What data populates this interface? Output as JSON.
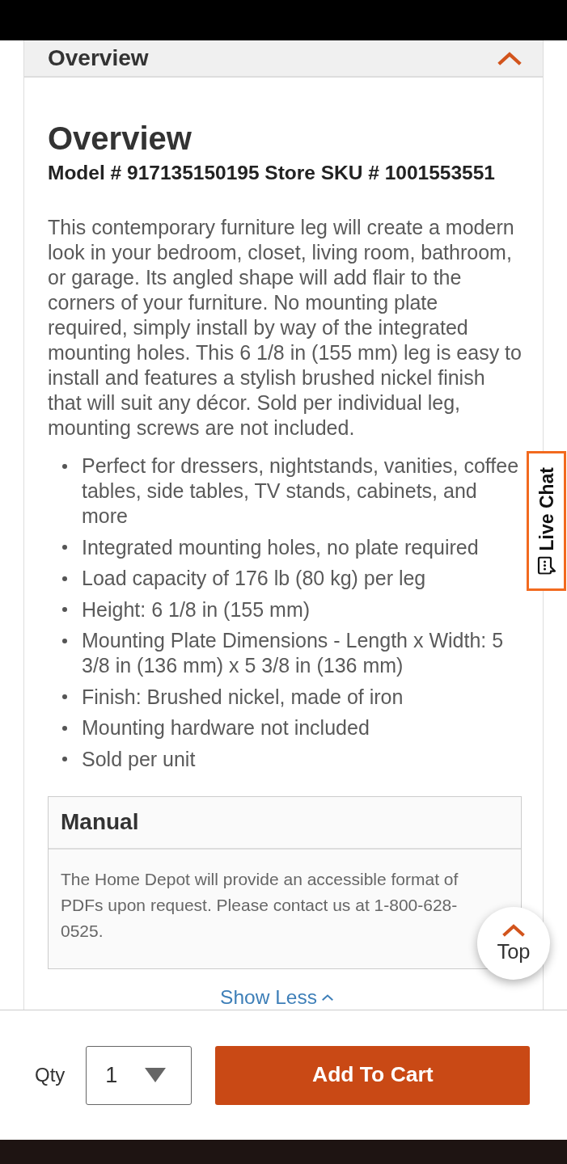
{
  "accordion": {
    "title": "Overview",
    "expanded": true
  },
  "overview": {
    "heading": "Overview",
    "model_line": "Model # 917135150195 Store SKU # 1001553551",
    "description": "This contemporary furniture leg will create a modern look in your bedroom, closet, living room, bathroom, or garage. Its angled shape will add flair to the corners of your furniture. No mounting plate required, simply install by way of the integrated mounting holes. This 6 1/8 in (155 mm) leg is easy to install and features a stylish brushed nickel finish that will suit any décor. Sold per individual leg, mounting screws are not included.",
    "features": [
      "Perfect for dressers, nightstands, vanities, coffee tables, side tables, TV stands, cabinets, and more",
      "Integrated mounting holes, no plate required",
      "Load capacity of 176 lb (80 kg) per leg",
      "Height: 6 1/8 in (155 mm)",
      "Mounting Plate Dimensions - Length x Width: 5 3/8 in (136 mm) x 5 3/8 in (136 mm)",
      "Finish: Brushed nickel, made of iron",
      "Mounting hardware not included",
      "Sold per unit"
    ]
  },
  "manual": {
    "title": "Manual",
    "text": "The Home Depot will provide an accessible format of PDFs upon request. Please contact us at 1-800-628-0525."
  },
  "show_less": {
    "label": "Show Less",
    "expanded": true
  },
  "live_chat": {
    "label": "Live Chat"
  },
  "top_button": {
    "label": "Top"
  },
  "cart_bar": {
    "qty_label": "Qty",
    "qty_value": "1",
    "button": "Add To Cart"
  }
}
